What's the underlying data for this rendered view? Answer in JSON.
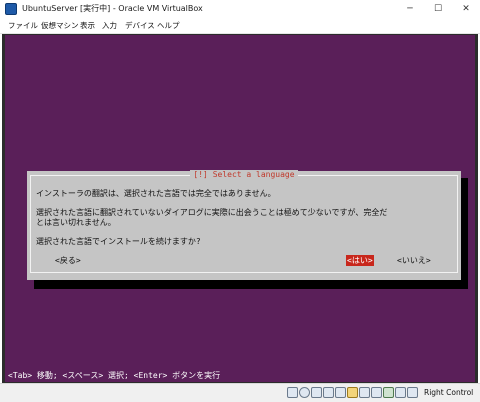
{
  "window": {
    "title": "UbuntuServer [実行中] - Oracle VM VirtualBox",
    "minimize_glyph": "─",
    "maximize_glyph": "☐",
    "close_glyph": "✕"
  },
  "menu": {
    "items": [
      "ファイル",
      "仮想マシン",
      "表示",
      "入力",
      "デバイス",
      "ヘルプ"
    ]
  },
  "dialog": {
    "title": "[!] Select a language",
    "line1": "インストーラの翻訳は、選択された言語では完全ではありません。",
    "line2": "選択された言語に翻訳されていないダイアログに実際に出会うことは極めて少ないですが、完全だ",
    "line3": "とは言い切れません。",
    "line4": "選択された言語でインストールを続けますか?",
    "back_button": "<戻る>",
    "yes_button": "<はい>",
    "no_button": "<いいえ>"
  },
  "console": {
    "status_line": "<Tab> 移動; <スペース> 選択; <Enter> ボタンを実行"
  },
  "statusbar": {
    "host_key": "Right Control",
    "icons": [
      "hard-disk-icon",
      "optical-drive-icon",
      "audio-icon",
      "network-icon",
      "usb-icon",
      "shared-folder-icon",
      "display-icon",
      "recording-icon",
      "cpu-icon",
      "mouse-integration-icon",
      "keyboard-icon"
    ]
  },
  "colors": {
    "console_background": "#5a1f59",
    "dialog_background": "#c5c5c5",
    "dialog_title": "#c0392b",
    "selected_button": "#c8271c"
  }
}
